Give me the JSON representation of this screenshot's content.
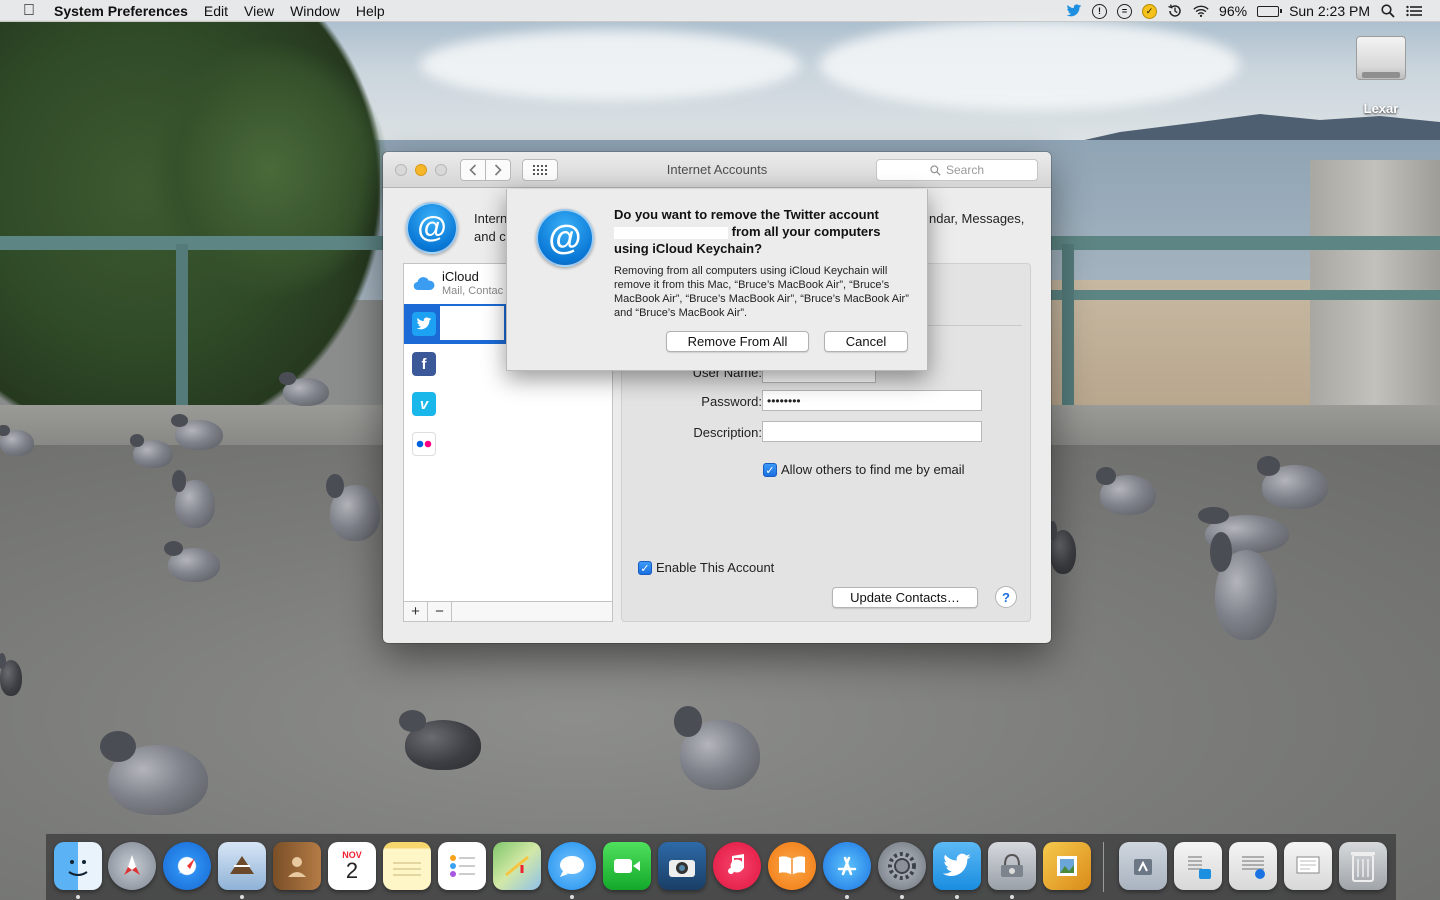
{
  "menubar": {
    "apple_icon": "apple-icon",
    "app_name": "System Preferences",
    "menus": [
      "Edit",
      "View",
      "Window",
      "Help"
    ],
    "status_icons": [
      "twitter-icon",
      "info-icon",
      "chat-icon",
      "tasks-icon",
      "time-machine-icon",
      "wifi-icon",
      "battery-icon",
      "spotlight-icon",
      "notification-center-icon"
    ],
    "battery_percent": "96%",
    "clock": "Sun 2:23 PM"
  },
  "desktop": {
    "drive_label": "Lexar"
  },
  "window": {
    "title": "Internet Accounts",
    "search_placeholder": "Search",
    "header_text_left": "Intern\nand c",
    "header_text_right": "ndar, Messages,",
    "accounts": [
      {
        "name": "iCloud",
        "subtitle": "Mail, Contac",
        "icon": "icloud-icon",
        "color": "#ffffff"
      },
      {
        "name": "",
        "subtitle": "",
        "icon": "twitter-icon",
        "color": "#1da1f2"
      },
      {
        "name": "",
        "subtitle": "",
        "icon": "facebook-icon",
        "color": "#3b5998"
      },
      {
        "name": "",
        "subtitle": "",
        "icon": "vimeo-icon",
        "color": "#1ab7ea"
      },
      {
        "name": "",
        "subtitle": "",
        "icon": "flickr-icon",
        "color": "#ffffff"
      }
    ],
    "add_label": "+",
    "remove_label": "−",
    "detail": {
      "username_label": "User Name:",
      "password_label": "Password:",
      "password_value": "••••••••",
      "description_label": "Description:",
      "description_value": "",
      "allow_find_label": "Allow others to find me by email",
      "allow_find_checked": true,
      "enable_label": "Enable This Account",
      "enable_checked": true,
      "update_contacts_label": "Update Contacts…",
      "help_label": "?"
    }
  },
  "alert": {
    "title_line1": "Do you want to remove the Twitter account",
    "title_line2": "from all your computers",
    "title_line3": "using iCloud Keychain?",
    "body": "Removing from all computers using iCloud Keychain will remove it from this Mac, “Bruce’s MacBook Air”, “Bruce’s MacBook Air”, “Bruce’s MacBook Air”, “Bruce’s MacBook Air” and “Bruce’s MacBook Air”.",
    "remove_button": "Remove From All",
    "cancel_button": "Cancel"
  },
  "dock": {
    "calendar_month": "NOV",
    "calendar_day": "2",
    "apps": [
      "finder",
      "launchpad",
      "safari",
      "mail",
      "contacts",
      "calendar",
      "notes",
      "reminders",
      "maps",
      "messages",
      "facetime",
      "photo-booth",
      "itunes",
      "ibooks",
      "app-store",
      "system-preferences",
      "twitter",
      "disk-utility",
      "preview",
      "applications-folder",
      "documents-stack",
      "downloads-stack",
      "screenshots-stack",
      "trash"
    ]
  }
}
